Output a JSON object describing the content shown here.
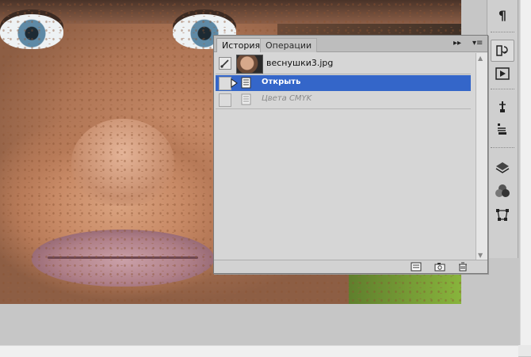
{
  "panel": {
    "tabs": [
      {
        "label": "История",
        "active": true
      },
      {
        "label": "Операции",
        "active": false
      }
    ],
    "snapshot": {
      "label": "веснушки3.jpg"
    },
    "history_items": [
      {
        "label": "Открыть",
        "selected": true
      },
      {
        "label": "Цвета CMYK",
        "selected": false,
        "dimmed": true
      }
    ],
    "footer_icons": [
      "new-document-from-state-icon",
      "camera-snapshot-icon",
      "trash-icon"
    ],
    "menu_icons": [
      "double-arrow-icon",
      "panel-menu-icon"
    ]
  },
  "dock": {
    "icons": [
      "paragraph-icon",
      "history-icon",
      "actions-play-icon",
      "tool-presets-icon",
      "clone-source-icon",
      "layers-icon",
      "channels-icon",
      "paths-icon"
    ],
    "active": "history-icon",
    "glyphs": {
      "paragraph": "¶"
    }
  },
  "colors": {
    "selection": "#3466c9",
    "panel_bg": "#d6d6d6"
  }
}
